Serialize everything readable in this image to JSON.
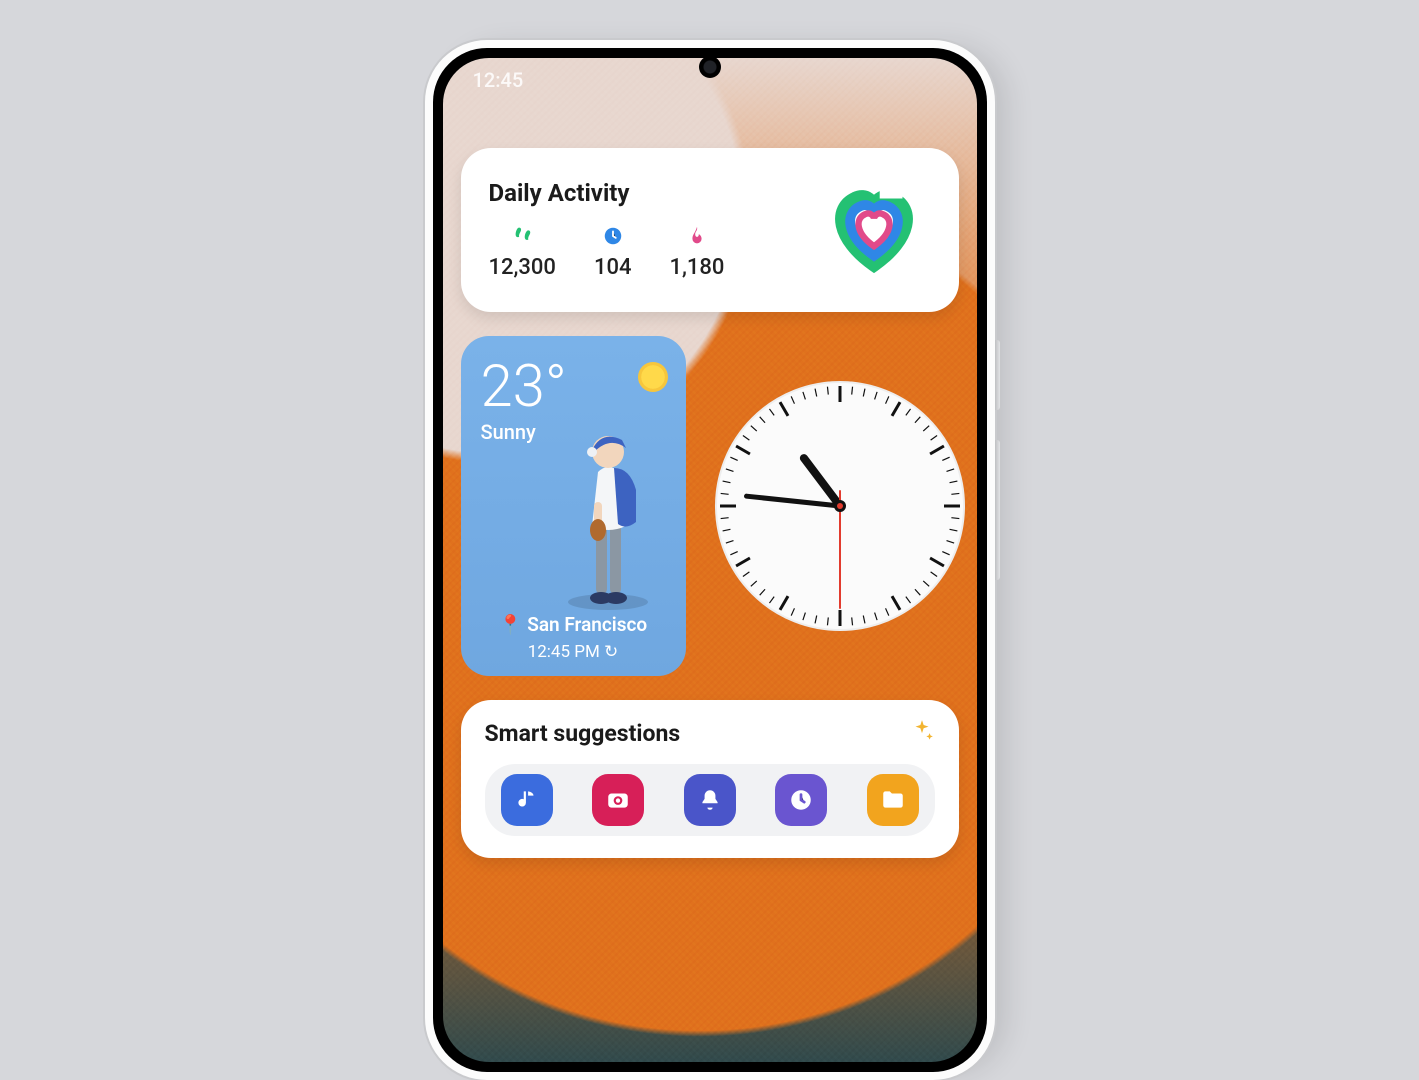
{
  "status": {
    "time": "12:45"
  },
  "activity": {
    "title": "Daily Activity",
    "steps": "12,300",
    "minutes": "104",
    "calories": "1,180"
  },
  "weather": {
    "temp": "23°",
    "condition": "Sunny",
    "location": "San Francisco",
    "time": "12:45 PM"
  },
  "clock": {
    "hour": 10,
    "minute": 46,
    "second": 30
  },
  "suggestions": {
    "title": "Smart suggestions",
    "apps": [
      "music",
      "camera",
      "bell",
      "clock",
      "files"
    ]
  },
  "colors": {
    "green": "#24c173",
    "blue": "#2f87e6",
    "pink": "#e14a8a",
    "orange": "#f05b2a"
  }
}
